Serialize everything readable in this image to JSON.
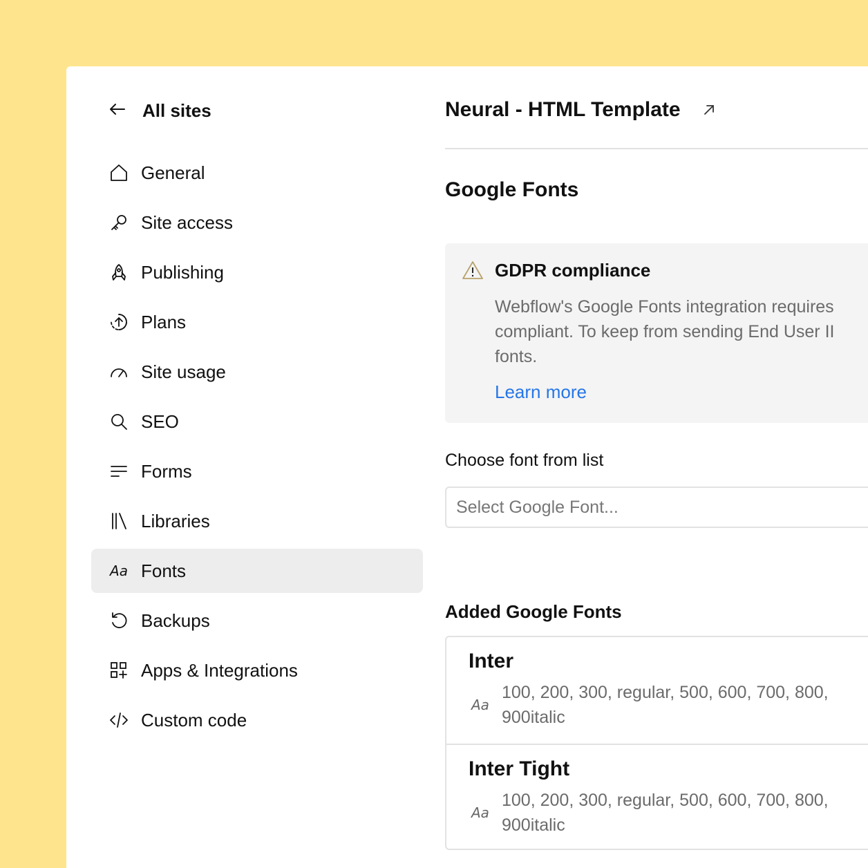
{
  "sidebar": {
    "back_label": "All sites",
    "items": [
      {
        "label": "General",
        "icon": "home-icon"
      },
      {
        "label": "Site access",
        "icon": "key-icon"
      },
      {
        "label": "Publishing",
        "icon": "rocket-icon"
      },
      {
        "label": "Plans",
        "icon": "upgrade-icon"
      },
      {
        "label": "Site usage",
        "icon": "gauge-icon"
      },
      {
        "label": "SEO",
        "icon": "search-icon"
      },
      {
        "label": "Forms",
        "icon": "lines-icon"
      },
      {
        "label": "Libraries",
        "icon": "library-icon"
      },
      {
        "label": "Fonts",
        "icon": "font-icon",
        "active": true
      },
      {
        "label": "Backups",
        "icon": "history-icon"
      },
      {
        "label": "Apps & Integrations",
        "icon": "apps-icon"
      },
      {
        "label": "Custom code",
        "icon": "code-icon"
      }
    ]
  },
  "header": {
    "site_title": "Neural - HTML Template"
  },
  "main": {
    "section_title": "Google Fonts",
    "notice": {
      "title": "GDPR compliance",
      "body_lines": [
        "Webflow's Google Fonts integration requires",
        "compliant. To keep from sending End User II",
        "fonts."
      ],
      "link": "Learn more"
    },
    "choose_label": "Choose font from list",
    "select_placeholder": "Select Google Font...",
    "added_title": "Added Google Fonts",
    "fonts": [
      {
        "name": "Inter",
        "icon_text": "Aa",
        "weights_line1": "100, 200, 300, regular, 500, 600, 700, 800,",
        "weights_line2": "900italic"
      },
      {
        "name": "Inter Tight",
        "icon_text": "Aa",
        "weights_line1": "100, 200, 300, regular, 500, 600, 700, 800,",
        "weights_line2": "900italic"
      }
    ]
  },
  "colors": {
    "background": "#FEE58D",
    "active_item": "#EDEDED",
    "link": "#2576E8",
    "notice_bg": "#F4F4F4",
    "warning": "#B8A26A"
  }
}
